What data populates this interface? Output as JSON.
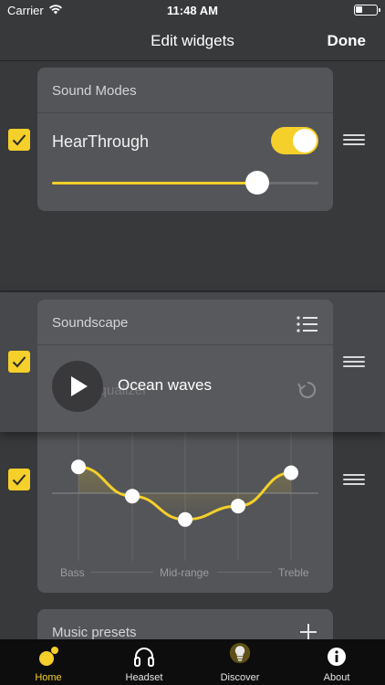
{
  "status_bar": {
    "carrier": "Carrier",
    "time": "11:48 AM"
  },
  "nav": {
    "title": "Edit widgets",
    "done_label": "Done"
  },
  "colors": {
    "accent": "#f5cf2a",
    "background": "#38393b",
    "card": "#545558",
    "tabbar": "#0d0d0d"
  },
  "widgets": {
    "sound_modes": {
      "title": "Sound Modes",
      "hearthrough_label": "HearThrough",
      "hearthrough_enabled": true,
      "level": 0.77,
      "checked": true
    },
    "soundscape": {
      "title": "Soundscape",
      "track": "Ocean waves",
      "hidden_title": "Music equalizer",
      "checked": true
    },
    "equalizer": {
      "checked": true,
      "bands": [
        0.45,
        -0.05,
        -0.45,
        -0.22,
        0.35
      ],
      "labels": {
        "bass": "Bass",
        "mid": "Mid-range",
        "treble": "Treble"
      }
    },
    "music_presets": {
      "title": "Music presets"
    }
  },
  "tabs": [
    {
      "label": "Home",
      "icon": "home-icon",
      "active": true
    },
    {
      "label": "Headset",
      "icon": "headset-icon",
      "active": false
    },
    {
      "label": "Discover",
      "icon": "lightbulb-icon",
      "active": false
    },
    {
      "label": "About",
      "icon": "info-icon",
      "active": false
    }
  ]
}
